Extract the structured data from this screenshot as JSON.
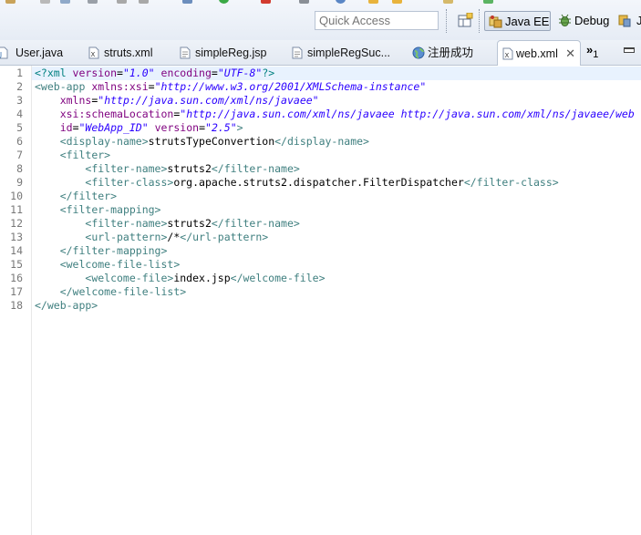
{
  "toolbar": {
    "quick_access_placeholder": "Quick Access",
    "perspectives": [
      {
        "label": "Java EE",
        "icon": "javaee-perspective-icon",
        "active": true
      },
      {
        "label": "Debug",
        "icon": "debug-perspective-icon",
        "active": false
      },
      {
        "label": "J",
        "icon": "java-perspective-icon",
        "active": false
      }
    ]
  },
  "tabs": [
    {
      "label": "User.java",
      "icon": "java-file-icon",
      "active": false
    },
    {
      "label": "struts.xml",
      "icon": "xml-file-icon",
      "active": false
    },
    {
      "label": "simpleReg.jsp",
      "icon": "jsp-file-icon",
      "active": false
    },
    {
      "label": "simpleRegSuc...",
      "icon": "jsp-file-icon",
      "active": false
    },
    {
      "label": "注册成功",
      "icon": "web-browser-icon",
      "active": false
    },
    {
      "label": "web.xml",
      "icon": "xml-file-icon",
      "active": true,
      "close": "✕"
    }
  ],
  "tab_overflow": {
    "glyph": "»",
    "count": "1"
  },
  "editor": {
    "line_numbers": [
      "1",
      "2",
      "3",
      "4",
      "5",
      "6",
      "7",
      "8",
      "9",
      "10",
      "11",
      "12",
      "13",
      "14",
      "15",
      "16",
      "17",
      "18"
    ],
    "lines": [
      [
        {
          "t": "pi",
          "s": "<?xml "
        },
        {
          "t": "attr",
          "s": "version"
        },
        {
          "t": "txt",
          "s": "="
        },
        {
          "t": "val",
          "s": "\"1.0\""
        },
        {
          "t": "txt",
          "s": " "
        },
        {
          "t": "attr",
          "s": "encoding"
        },
        {
          "t": "txt",
          "s": "="
        },
        {
          "t": "val",
          "s": "\"UTF-8\""
        },
        {
          "t": "pi",
          "s": "?>"
        }
      ],
      [
        {
          "t": "tag",
          "s": "<web-app "
        },
        {
          "t": "attr",
          "s": "xmlns:xsi"
        },
        {
          "t": "txt",
          "s": "="
        },
        {
          "t": "val",
          "s": "\"http://www.w3.org/2001/XMLSchema-instance\""
        }
      ],
      [
        {
          "t": "txt",
          "s": "    "
        },
        {
          "t": "attr",
          "s": "xmlns"
        },
        {
          "t": "txt",
          "s": "="
        },
        {
          "t": "val",
          "s": "\"http://java.sun.com/xml/ns/javaee\""
        }
      ],
      [
        {
          "t": "txt",
          "s": "    "
        },
        {
          "t": "attr",
          "s": "xsi:schemaLocation"
        },
        {
          "t": "txt",
          "s": "="
        },
        {
          "t": "val",
          "s": "\"http://java.sun.com/xml/ns/javaee http://java.sun.com/xml/ns/javaee/web"
        }
      ],
      [
        {
          "t": "txt",
          "s": "    "
        },
        {
          "t": "attr",
          "s": "id"
        },
        {
          "t": "txt",
          "s": "="
        },
        {
          "t": "val",
          "s": "\"WebApp_ID\""
        },
        {
          "t": "txt",
          "s": " "
        },
        {
          "t": "attr",
          "s": "version"
        },
        {
          "t": "txt",
          "s": "="
        },
        {
          "t": "val",
          "s": "\"2.5\""
        },
        {
          "t": "tag",
          "s": ">"
        }
      ],
      [
        {
          "t": "txt",
          "s": "    "
        },
        {
          "t": "tag",
          "s": "<display-name>"
        },
        {
          "t": "txt",
          "s": "strutsTypeConvertion"
        },
        {
          "t": "tag",
          "s": "</display-name>"
        }
      ],
      [
        {
          "t": "txt",
          "s": "    "
        },
        {
          "t": "tag",
          "s": "<filter>"
        }
      ],
      [
        {
          "t": "txt",
          "s": "        "
        },
        {
          "t": "tag",
          "s": "<filter-name>"
        },
        {
          "t": "txt",
          "s": "struts2"
        },
        {
          "t": "tag",
          "s": "</filter-name>"
        }
      ],
      [
        {
          "t": "txt",
          "s": "        "
        },
        {
          "t": "tag",
          "s": "<filter-class>"
        },
        {
          "t": "txt",
          "s": "org.apache.struts2.dispatcher.FilterDispatcher"
        },
        {
          "t": "tag",
          "s": "</filter-class>"
        }
      ],
      [
        {
          "t": "txt",
          "s": "    "
        },
        {
          "t": "tag",
          "s": "</filter>"
        }
      ],
      [
        {
          "t": "txt",
          "s": "    "
        },
        {
          "t": "tag",
          "s": "<filter-mapping>"
        }
      ],
      [
        {
          "t": "txt",
          "s": "        "
        },
        {
          "t": "tag",
          "s": "<filter-name>"
        },
        {
          "t": "txt",
          "s": "struts2"
        },
        {
          "t": "tag",
          "s": "</filter-name>"
        }
      ],
      [
        {
          "t": "txt",
          "s": "        "
        },
        {
          "t": "tag",
          "s": "<url-pattern>"
        },
        {
          "t": "txt",
          "s": "/*"
        },
        {
          "t": "tag",
          "s": "</url-pattern>"
        }
      ],
      [
        {
          "t": "txt",
          "s": "    "
        },
        {
          "t": "tag",
          "s": "</filter-mapping>"
        }
      ],
      [
        {
          "t": "txt",
          "s": "    "
        },
        {
          "t": "tag",
          "s": "<welcome-file-list>"
        }
      ],
      [
        {
          "t": "txt",
          "s": "        "
        },
        {
          "t": "tag",
          "s": "<welcome-file>"
        },
        {
          "t": "txt",
          "s": "index.jsp"
        },
        {
          "t": "tag",
          "s": "</welcome-file>"
        }
      ],
      [
        {
          "t": "txt",
          "s": "    "
        },
        {
          "t": "tag",
          "s": "</welcome-file-list>"
        }
      ],
      [
        {
          "t": "tag",
          "s": "</web-app>"
        }
      ]
    ]
  },
  "colors": {
    "xml_tag": "#3f7f7f",
    "xml_attribute": "#7f007f",
    "xml_value": "#2a00ff",
    "current_line": "#e8f2fe"
  }
}
